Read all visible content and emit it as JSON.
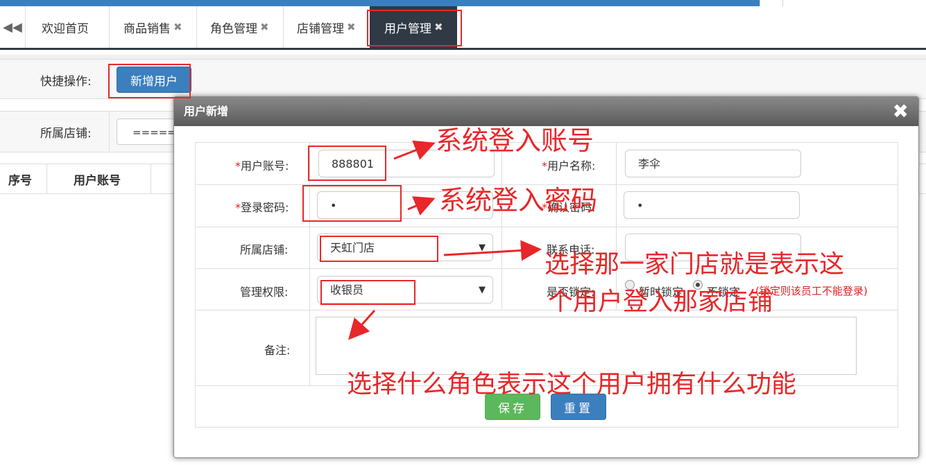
{
  "tabs": {
    "home": "欢迎首页",
    "sales": "商品销售",
    "roles": "角色管理",
    "stores": "店铺管理",
    "users": "用户管理",
    "close_glyph": "✖",
    "back_glyph": "◀◀"
  },
  "quick": {
    "label": "快捷操作:",
    "add_user": "新增用户"
  },
  "search": {
    "store_label": "所属店铺:",
    "store_value": "====="
  },
  "grid": {
    "col_index": "序号",
    "col_account": "用户账号"
  },
  "modal": {
    "title": "用户新增",
    "close_glyph": "✖",
    "required_mark": "*",
    "account_label": "用户账号:",
    "account_value": "888801",
    "name_label": "用户名称:",
    "name_value": "李伞",
    "password_label": "登录密码:",
    "password_value": "•",
    "confirm_label": "确认密码:",
    "confirm_value": "•",
    "store_label": "所属店铺:",
    "store_value": "天虹门店",
    "phone_label": "联系电话:",
    "role_label": "管理权限:",
    "role_value": "收银员",
    "lock_label": "是否锁定:",
    "lock_option_on": "暂时锁定",
    "lock_option_off": "不锁定",
    "lock_hint": "(锁定则该员工不能登录)",
    "lock_selected": "不锁定",
    "remark_label": "备注:",
    "save": "保存",
    "reset": "重置",
    "caret": "▼"
  },
  "annotations": {
    "account": "系统登入账号",
    "password": "系统登入密码",
    "store_line1": "选择那一家门店就是表示这",
    "store_line2": "个用户登入那家店铺",
    "role": "选择什么角色表示这个用户拥有什么功能"
  },
  "colors": {
    "annotation_red": "#e8272a",
    "tab_active": "#2f3a45",
    "primary_blue": "#3c7fbf",
    "save_green": "#5cb85c",
    "required_red": "#e02020"
  }
}
